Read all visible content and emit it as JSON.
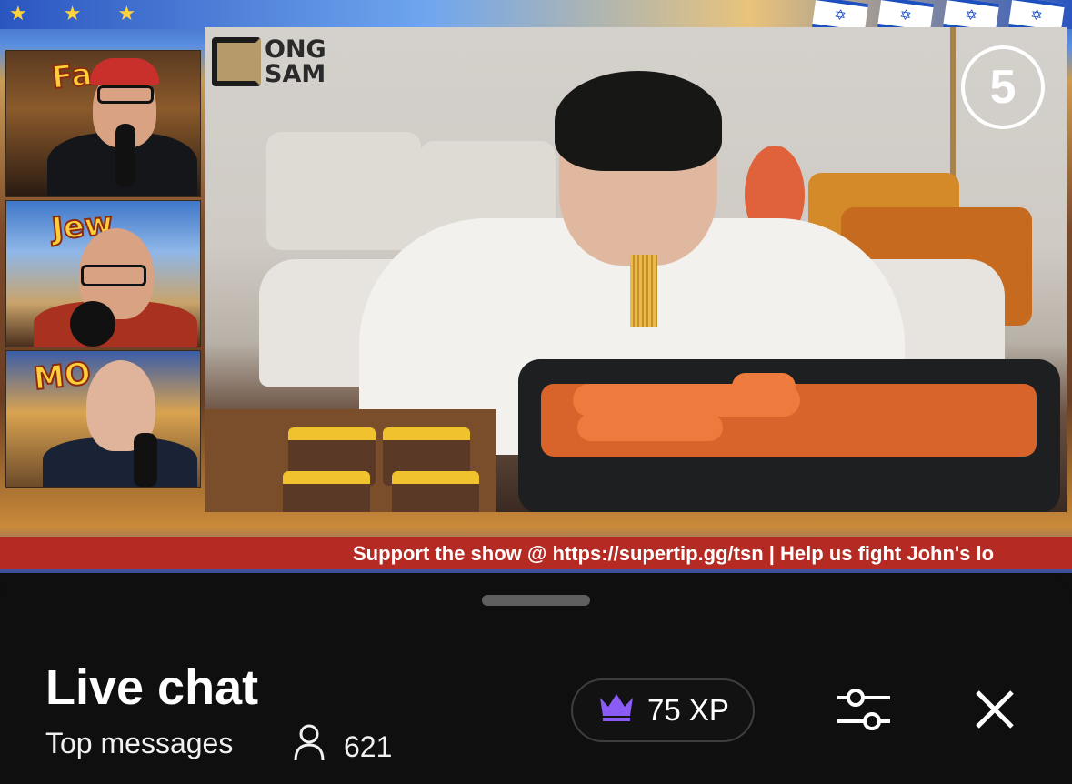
{
  "stream": {
    "ticker_text": "Support the show @ https://supertip.gg/tsn | Help us fight John's lo",
    "main_video_logo": [
      "ONG",
      "SAM"
    ],
    "main_video_badge": "5",
    "cam_titles": [
      "Fa",
      "Jew",
      "MO"
    ]
  },
  "chat_sheet": {
    "title": "Live chat",
    "filter_label": "Top messages",
    "viewer_count": "621",
    "xp_label": "75 XP"
  },
  "icons": [
    "crown-icon",
    "person-icon",
    "sliders-icon",
    "close-icon"
  ],
  "colors": {
    "sheet_bg": "#0f0f0f",
    "ticker_bg": "#b52a22",
    "crown": "#8a5cf5",
    "text": "#ffffff"
  }
}
